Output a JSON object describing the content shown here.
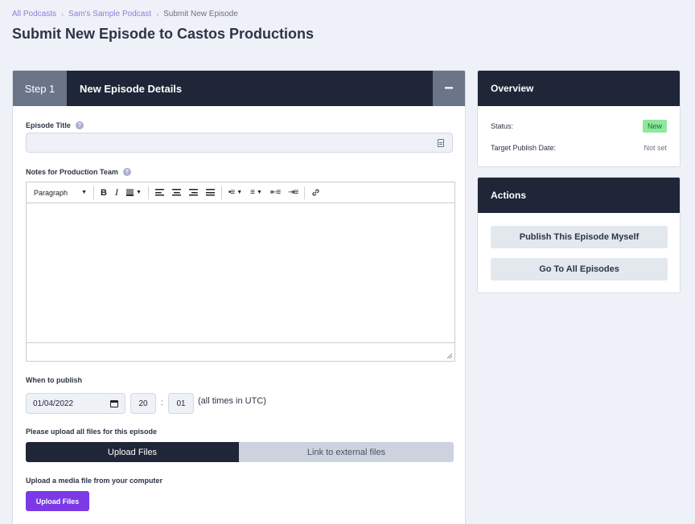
{
  "breadcrumb": {
    "items": [
      "All Podcasts",
      "Sam's Sample Podcast"
    ],
    "current": "Submit New Episode"
  },
  "page": {
    "title": "Submit New Episode to Castos Productions"
  },
  "step": {
    "label": "Step 1",
    "title": "New Episode Details",
    "collapse_symbol": "−"
  },
  "form": {
    "episode_title_label": "Episode Title",
    "episode_title_value": "",
    "notes_label": "Notes for Production Team",
    "toolbar": {
      "paragraph": "Paragraph",
      "bold": "B",
      "italic": "I"
    },
    "when_label": "When to publish",
    "date_value": "01/04/2022",
    "hour_value": "20",
    "minute_value": "01",
    "time_sep": ":",
    "utc_note": "(all times in UTC)",
    "upload_label": "Please upload all files for this episode",
    "toggle_upload": "Upload Files",
    "toggle_link": "Link to external files",
    "media_label": "Upload a media file from your computer",
    "upload_button": "Upload Files"
  },
  "overview": {
    "title": "Overview",
    "status_label": "Status:",
    "status_value": "New",
    "target_label": "Target Publish Date:",
    "target_value": "Not set"
  },
  "actions": {
    "title": "Actions",
    "publish_button": "Publish This Episode Myself",
    "episodes_button": "Go To All Episodes"
  },
  "colors": {
    "navy": "#1f2638",
    "slate": "#6a7588",
    "purple": "#7b3ae6",
    "badge_green": "#8ee89e",
    "link": "#8c7fd9"
  }
}
